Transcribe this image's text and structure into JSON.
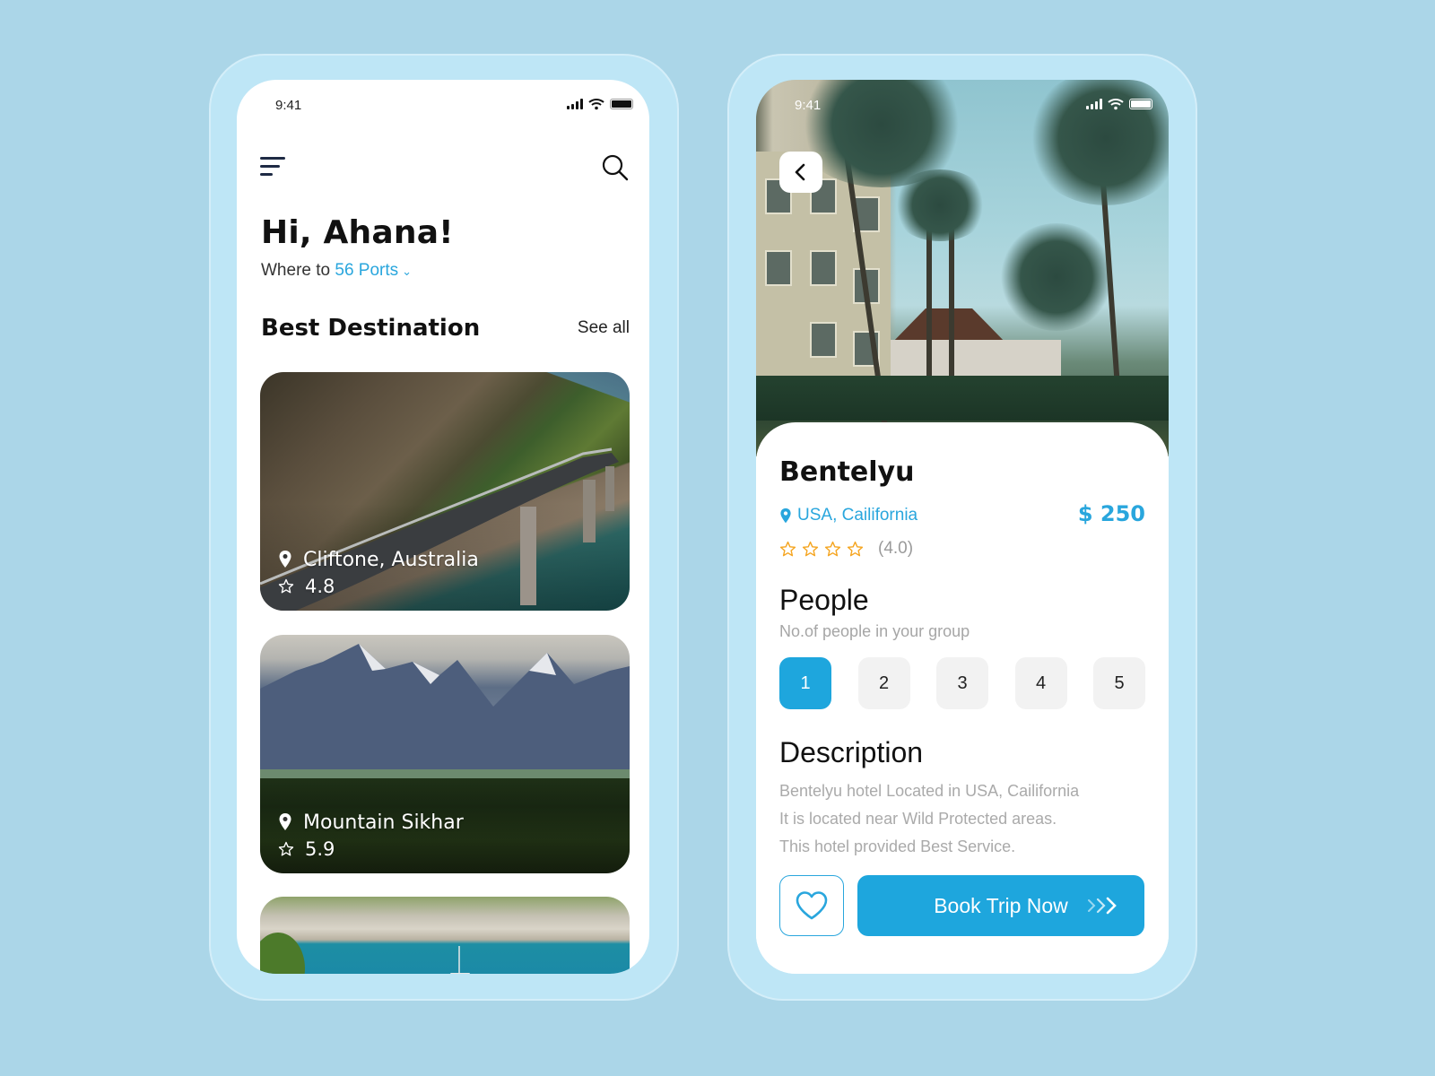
{
  "theme": {
    "accent": "#1ea6dd",
    "accent_text": "#29a6dd",
    "background": "#abd6e8",
    "frame": "#bee6f6",
    "star_color": "#f5a623"
  },
  "home_screen": {
    "status_bar": {
      "time": "9:41",
      "icons": [
        "signal-icon",
        "wifi-icon",
        "battery-icon"
      ]
    },
    "header": {
      "menu_icon": "menu-icon",
      "search_icon": "search-icon"
    },
    "greeting": "Hi, Ahana!",
    "subtitle": {
      "prefix": "Where to",
      "ports_link": "56 Ports",
      "dropdown_icon": "chevron-down-icon"
    },
    "section": {
      "title": "Best Destination",
      "see_all": "See all"
    },
    "destinations": [
      {
        "name": "Cliftone, Australia",
        "rating": "4.8",
        "image": "coastal-bridge-cliff"
      },
      {
        "name": "Mountain Sikhar",
        "rating": "5.9",
        "image": "snowy-mountains-forest"
      },
      {
        "name": "",
        "rating": "",
        "image": "turquoise-bay-sailboat"
      }
    ]
  },
  "detail_screen": {
    "status_bar": {
      "time": "9:41",
      "icons": [
        "signal-icon",
        "wifi-icon",
        "battery-icon"
      ]
    },
    "back_icon": "chevron-left-icon",
    "hero_image": "palm-tree-hotel",
    "hotel": {
      "name": "Bentelyu",
      "location": "USA, Cailifornia",
      "price": "$ 250",
      "stars": 4,
      "rating_text": "(4.0)"
    },
    "people": {
      "title": "People",
      "subtitle": "No.of people in your group",
      "options": [
        "1",
        "2",
        "3",
        "4",
        "5"
      ],
      "selected": "1"
    },
    "description": {
      "title": "Description",
      "lines": [
        "Bentelyu hotel Located in USA, Cailifornia",
        "It is located near Wild Protected areas.",
        "This hotel provided Best Service."
      ]
    },
    "actions": {
      "favorite_icon": "heart-icon",
      "book_label": "Book Trip Now",
      "book_icon": "chevrons-right-icon"
    }
  }
}
